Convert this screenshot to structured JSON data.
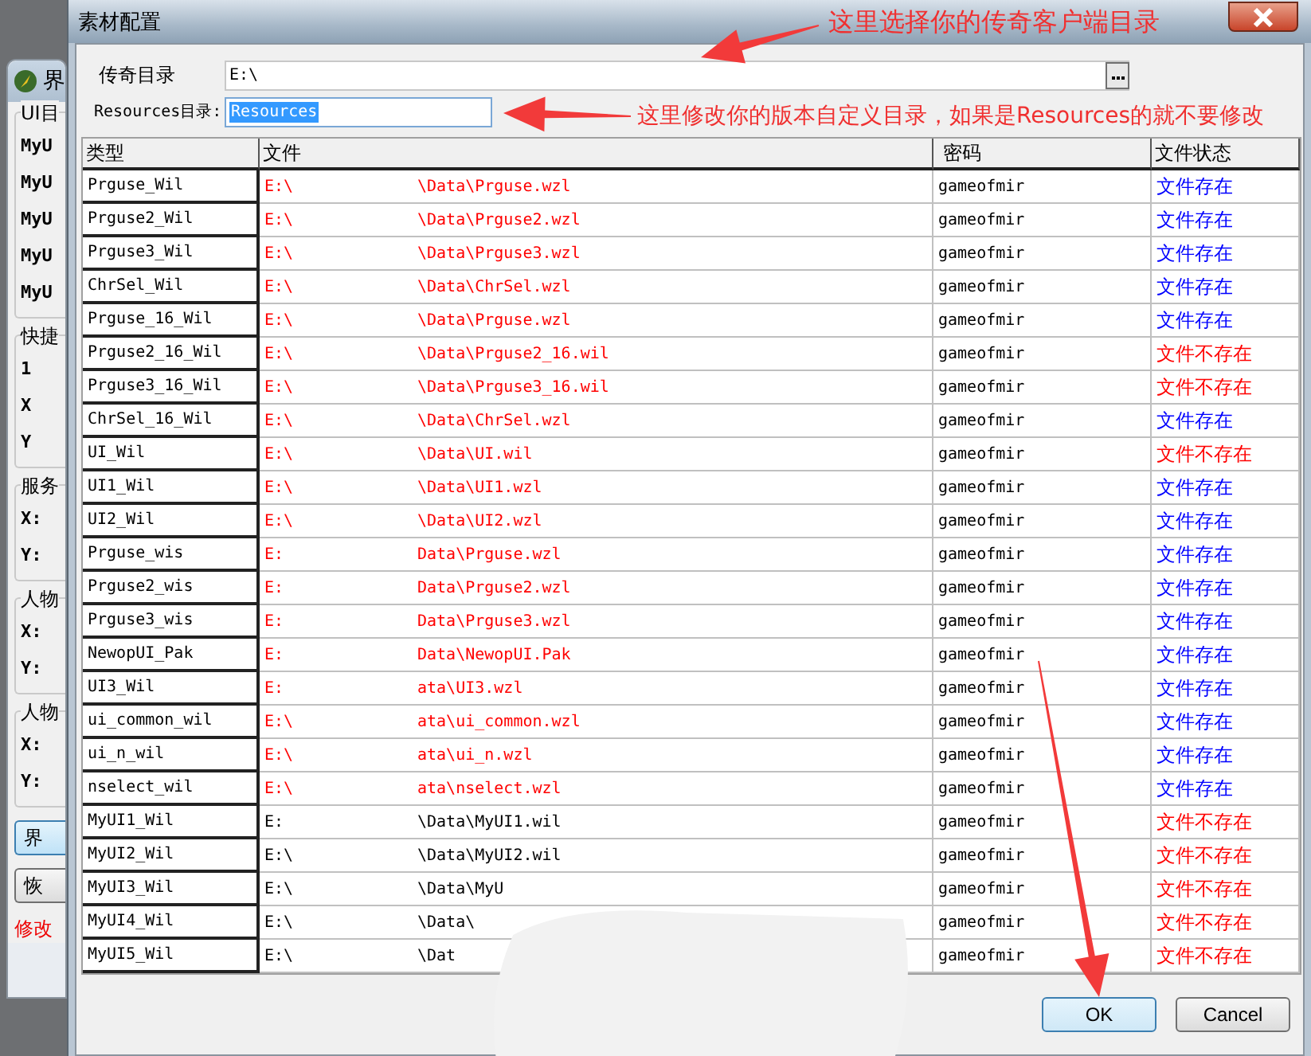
{
  "background_window": {
    "title": "界",
    "groups": [
      {
        "label": "UI目",
        "items": [
          "MyU",
          "MyU",
          "MyU",
          "MyU",
          "MyU"
        ]
      },
      {
        "label": "快捷",
        "items": [
          "1",
          "X",
          "Y"
        ]
      },
      {
        "label": "服务",
        "items": [
          "X:",
          "Y:"
        ]
      },
      {
        "label": "人物",
        "items": [
          "X:",
          "Y:"
        ]
      },
      {
        "label": "人物",
        "items": [
          "X:",
          "Y:"
        ]
      }
    ],
    "buttons": [
      {
        "label": "界",
        "focused": true
      },
      {
        "label": "恢",
        "focused": false
      }
    ],
    "note": "修改"
  },
  "dialog": {
    "title": "素材配置",
    "client_dir": {
      "label": "传奇目录",
      "value": "E:\\"
    },
    "resources_dir": {
      "label": "Resources目录:",
      "value": "Resources",
      "text_selected": true
    },
    "table": {
      "columns": [
        "类型",
        "文件",
        "密码",
        "文件状态"
      ],
      "rows": [
        {
          "type": "Prguse_Wil",
          "file_start": "E:\\",
          "file_end": "\\Data\\Prguse.wzl",
          "highlighted": true,
          "password": "gameofmir",
          "status": "文件存在",
          "exists": true
        },
        {
          "type": "Prguse2_Wil",
          "file_start": "E:\\",
          "file_end": "\\Data\\Prguse2.wzl",
          "highlighted": true,
          "password": "gameofmir",
          "status": "文件存在",
          "exists": true
        },
        {
          "type": "Prguse3_Wil",
          "file_start": "E:\\",
          "file_end": "\\Data\\Prguse3.wzl",
          "highlighted": true,
          "password": "gameofmir",
          "status": "文件存在",
          "exists": true
        },
        {
          "type": "ChrSel_Wil",
          "file_start": "E:\\",
          "file_end": "\\Data\\ChrSel.wzl",
          "highlighted": true,
          "password": "gameofmir",
          "status": "文件存在",
          "exists": true
        },
        {
          "type": "Prguse_16_Wil",
          "file_start": "E:\\",
          "file_end": "\\Data\\Prguse.wzl",
          "highlighted": true,
          "password": "gameofmir",
          "status": "文件存在",
          "exists": true
        },
        {
          "type": "Prguse2_16_Wil",
          "file_start": "E:\\",
          "file_end": "\\Data\\Prguse2_16.wil",
          "highlighted": true,
          "password": "gameofmir",
          "status": "文件不存在",
          "exists": false
        },
        {
          "type": "Prguse3_16_Wil",
          "file_start": "E:\\",
          "file_end": "\\Data\\Prguse3_16.wil",
          "highlighted": true,
          "password": "gameofmir",
          "status": "文件不存在",
          "exists": false
        },
        {
          "type": "ChrSel_16_Wil",
          "file_start": "E:\\",
          "file_end": "\\Data\\ChrSel.wzl",
          "highlighted": true,
          "password": "gameofmir",
          "status": "文件存在",
          "exists": true
        },
        {
          "type": "UI_Wil",
          "file_start": "E:\\",
          "file_end": "\\Data\\UI.wil",
          "highlighted": true,
          "password": "gameofmir",
          "status": "文件不存在",
          "exists": false
        },
        {
          "type": "UI1_Wil",
          "file_start": "E:\\",
          "file_end": "\\Data\\UI1.wzl",
          "highlighted": true,
          "password": "gameofmir",
          "status": "文件存在",
          "exists": true
        },
        {
          "type": "UI2_Wil",
          "file_start": "E:\\",
          "file_end": "\\Data\\UI2.wzl",
          "highlighted": true,
          "password": "gameofmir",
          "status": "文件存在",
          "exists": true
        },
        {
          "type": "Prguse_wis",
          "file_start": "E:",
          "file_end": "Data\\Prguse.wzl",
          "highlighted": true,
          "password": "gameofmir",
          "status": "文件存在",
          "exists": true
        },
        {
          "type": "Prguse2_wis",
          "file_start": "E:",
          "file_end": "Data\\Prguse2.wzl",
          "highlighted": true,
          "password": "gameofmir",
          "status": "文件存在",
          "exists": true
        },
        {
          "type": "Prguse3_wis",
          "file_start": "E:",
          "file_end": "Data\\Prguse3.wzl",
          "highlighted": true,
          "password": "gameofmir",
          "status": "文件存在",
          "exists": true
        },
        {
          "type": "NewopUI_Pak",
          "file_start": "E:",
          "file_end": "Data\\NewopUI.Pak",
          "highlighted": true,
          "password": "gameofmir",
          "status": "文件存在",
          "exists": true
        },
        {
          "type": "UI3_Wil",
          "file_start": "E:",
          "file_end": "ata\\UI3.wzl",
          "highlighted": true,
          "password": "gameofmir",
          "status": "文件存在",
          "exists": true
        },
        {
          "type": "ui_common_wil",
          "file_start": "E:\\",
          "file_end": "ata\\ui_common.wzl",
          "highlighted": true,
          "password": "gameofmir",
          "status": "文件存在",
          "exists": true
        },
        {
          "type": "ui_n_wil",
          "file_start": "E:\\",
          "file_end": "ata\\ui_n.wzl",
          "highlighted": true,
          "password": "gameofmir",
          "status": "文件存在",
          "exists": true
        },
        {
          "type": "nselect_wil",
          "file_start": "E:\\",
          "file_end": "ata\\nselect.wzl",
          "highlighted": true,
          "password": "gameofmir",
          "status": "文件存在",
          "exists": true
        },
        {
          "type": "MyUI1_Wil",
          "file_start": "E:",
          "file_end": "\\Data\\MyUI1.wil",
          "highlighted": false,
          "password": "gameofmir",
          "status": "文件不存在",
          "exists": false
        },
        {
          "type": "MyUI2_Wil",
          "file_start": "E:\\",
          "file_end": "\\Data\\MyUI2.wil",
          "highlighted": false,
          "password": "gameofmir",
          "status": "文件不存在",
          "exists": false
        },
        {
          "type": "MyUI3_Wil",
          "file_start": "E:\\",
          "file_end": "\\Data\\MyU",
          "highlighted": false,
          "password": "gameofmir",
          "status": "文件不存在",
          "exists": false
        },
        {
          "type": "MyUI4_Wil",
          "file_start": "E:\\",
          "file_end": "\\Data\\",
          "highlighted": false,
          "password": "gameofmir",
          "status": "文件不存在",
          "exists": false
        },
        {
          "type": "MyUI5_Wil",
          "file_start": "E:\\",
          "file_end": "\\Dat",
          "highlighted": false,
          "password": "gameofmir",
          "status": "文件不存在",
          "exists": false
        }
      ]
    },
    "buttons": [
      {
        "label": "OK",
        "focused": true
      },
      {
        "label": "Cancel",
        "focused": false
      }
    ]
  },
  "annotations": [
    "这里选择你的传奇客户端目录",
    "这里修改你的版本自定义目录，如果是Resources的就不要修改"
  ]
}
